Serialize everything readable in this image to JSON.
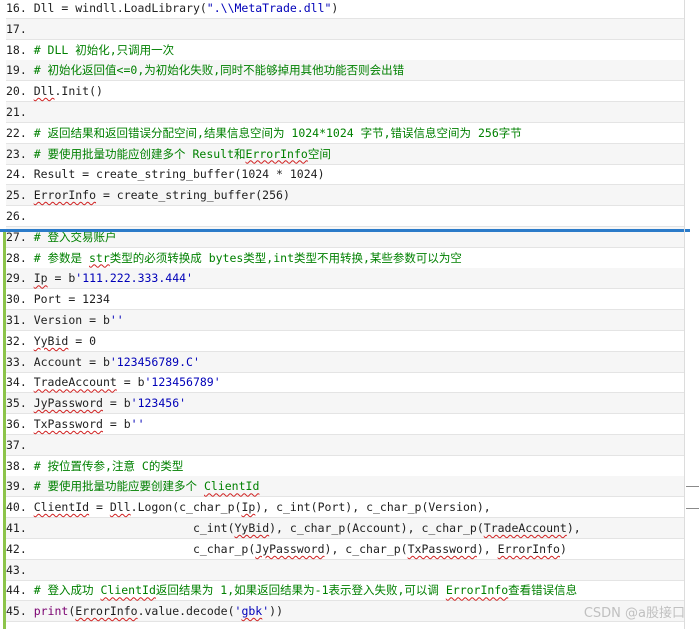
{
  "watermark": "CSDN @a股接口",
  "accent_color": "#2b7bc9",
  "lines": [
    {
      "n": "16",
      "segs": [
        {
          "t": "Dll = windll.LoadLibrary("
        },
        {
          "t": "\".\\\\MetaTrade.dll\"",
          "c": "s"
        },
        {
          "t": ")"
        }
      ]
    },
    {
      "n": "17",
      "segs": []
    },
    {
      "n": "18",
      "segs": [
        {
          "t": "# DLL 初始化,只调用一次",
          "c": "c"
        }
      ]
    },
    {
      "n": "19",
      "segs": [
        {
          "t": "# 初始化返回值<=0,为初始化失败,同时不能够掉用其他功能否则会出错",
          "c": "c"
        }
      ]
    },
    {
      "n": "20",
      "segs": [
        {
          "t": "Dll",
          "sq": true
        },
        {
          "t": ".Init()"
        }
      ]
    },
    {
      "n": "21",
      "segs": []
    },
    {
      "n": "22",
      "segs": [
        {
          "t": "# 返回结果和返回错误分配空间,结果信息空间为 1024*1024 字节,错误信息空间为 256字节",
          "c": "c"
        }
      ]
    },
    {
      "n": "23",
      "segs": [
        {
          "t": "# 要使用批量功能应创建多个 Result和",
          "c": "c"
        },
        {
          "t": "ErrorInfo",
          "c": "c",
          "sq": true
        },
        {
          "t": "空间",
          "c": "c"
        }
      ]
    },
    {
      "n": "24",
      "segs": [
        {
          "t": "Result = create_string_buffer(1024 * 1024)"
        }
      ]
    },
    {
      "n": "25",
      "segs": [
        {
          "t": "ErrorInfo",
          "sq": true
        },
        {
          "t": " = create_string_buffer(256)"
        }
      ]
    },
    {
      "n": "26",
      "segs": []
    },
    {
      "n": "27",
      "segs": [
        {
          "t": "# 登入交易账户",
          "c": "c"
        }
      ]
    },
    {
      "n": "28",
      "segs": [
        {
          "t": "# 参数是 ",
          "c": "c"
        },
        {
          "t": "str",
          "c": "c",
          "sq": true
        },
        {
          "t": "类型的必须转换成 bytes类型,int类型不用转换,某些参数可以为空",
          "c": "c"
        }
      ]
    },
    {
      "n": "29",
      "segs": [
        {
          "t": "Ip",
          "sq": true
        },
        {
          "t": " = b"
        },
        {
          "t": "'111.222.333.444'",
          "c": "s"
        }
      ]
    },
    {
      "n": "30",
      "segs": [
        {
          "t": "Port = 1234"
        }
      ]
    },
    {
      "n": "31",
      "segs": [
        {
          "t": "Version = b"
        },
        {
          "t": "''",
          "c": "s"
        }
      ]
    },
    {
      "n": "32",
      "segs": [
        {
          "t": "YyBid",
          "sq": true
        },
        {
          "t": " = 0"
        }
      ]
    },
    {
      "n": "33",
      "segs": [
        {
          "t": "Account = b"
        },
        {
          "t": "'123456789.C'",
          "c": "s"
        }
      ]
    },
    {
      "n": "34",
      "segs": [
        {
          "t": "TradeAccount",
          "sq": true
        },
        {
          "t": " = b"
        },
        {
          "t": "'123456789'",
          "c": "s"
        }
      ]
    },
    {
      "n": "35",
      "segs": [
        {
          "t": "JyPassword",
          "sq": true
        },
        {
          "t": " = b"
        },
        {
          "t": "'123456'",
          "c": "s"
        }
      ]
    },
    {
      "n": "36",
      "segs": [
        {
          "t": "TxPassword",
          "sq": true
        },
        {
          "t": " = b"
        },
        {
          "t": "''",
          "c": "s"
        }
      ]
    },
    {
      "n": "37",
      "segs": []
    },
    {
      "n": "38",
      "segs": [
        {
          "t": "# 按位置传参,注意 C的类型",
          "c": "c"
        }
      ]
    },
    {
      "n": "39",
      "segs": [
        {
          "t": "# 要使用批量功能应要创建多个 ",
          "c": "c"
        },
        {
          "t": "ClientId",
          "c": "c",
          "sq": true
        }
      ]
    },
    {
      "n": "40",
      "segs": [
        {
          "t": "ClientId",
          "sq": true
        },
        {
          "t": " = "
        },
        {
          "t": "Dll",
          "sq": true
        },
        {
          "t": ".Logon(c_char_p("
        },
        {
          "t": "Ip",
          "sq": true
        },
        {
          "t": "), c_int(Port), c_char_p(Version),"
        }
      ]
    },
    {
      "n": "41",
      "segs": [
        {
          "t": "                       c_int("
        },
        {
          "t": "YyBid",
          "sq": true
        },
        {
          "t": "), c_char_p(Account), c_char_p("
        },
        {
          "t": "TradeAccount",
          "sq": true
        },
        {
          "t": "),"
        }
      ]
    },
    {
      "n": "42",
      "segs": [
        {
          "t": "                       c_char_p("
        },
        {
          "t": "JyPassword",
          "sq": true
        },
        {
          "t": "), c_char_p("
        },
        {
          "t": "TxPassword",
          "sq": true
        },
        {
          "t": "), "
        },
        {
          "t": "ErrorInfo",
          "sq": true
        },
        {
          "t": ")"
        }
      ]
    },
    {
      "n": "43",
      "segs": []
    },
    {
      "n": "44",
      "segs": [
        {
          "t": "# 登入成功 ",
          "c": "c"
        },
        {
          "t": "ClientId",
          "c": "c",
          "sq": true
        },
        {
          "t": "返回结果为 1,如果返回结果为-1表示登入失败,可以调 ",
          "c": "c"
        },
        {
          "t": "ErrorInfo",
          "c": "c",
          "sq": true
        },
        {
          "t": "查看错误信息",
          "c": "c"
        }
      ]
    },
    {
      "n": "45",
      "segs": [
        {
          "t": "print",
          "c": "f"
        },
        {
          "t": "("
        },
        {
          "t": "ErrorInfo",
          "sq": true
        },
        {
          "t": ".value.decode("
        },
        {
          "t": "'",
          "c": "s"
        },
        {
          "t": "gbk",
          "c": "s",
          "sq": true
        },
        {
          "t": "'",
          "c": "s"
        },
        {
          "t": "))"
        }
      ]
    }
  ]
}
